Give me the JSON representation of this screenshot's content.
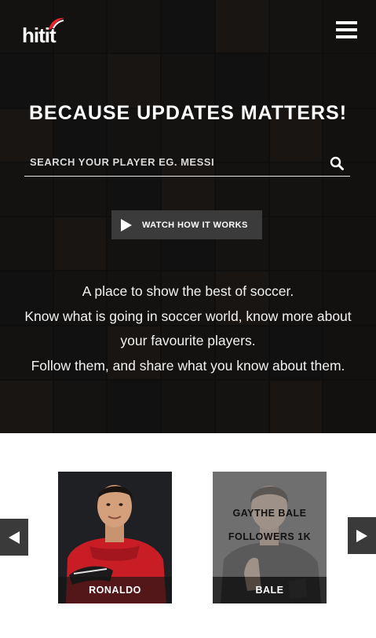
{
  "header": {
    "logo_text": "hitit",
    "menu_icon": "hamburger-menu-icon"
  },
  "hero": {
    "headline": "BECAUSE UPDATES MATTERS!",
    "search": {
      "placeholder": "SEARCH YOUR PLAYER EG. MESSI",
      "value": "",
      "icon": "search-icon"
    },
    "watch_button": {
      "label": "WATCH HOW IT WORKS",
      "icon": "play-icon"
    },
    "tagline": [
      "A place to show the best of soccer.",
      "Know what is going in soccer world, know more about your favourite players.",
      "Follow them, and share what you know about them."
    ]
  },
  "carousel": {
    "prev_icon": "arrow-left-icon",
    "next_icon": "arrow-right-icon",
    "players": [
      {
        "label": "RONALDO"
      },
      {
        "label": "BALE",
        "hover_name": "GAYTHE BALE",
        "hover_followers": "FOLLOWERS 1K"
      }
    ]
  },
  "colors": {
    "hero_overlay": "#0a0a0a",
    "button_bg": "#3b3b3b",
    "text_light": "#ffffff",
    "logo_accent": "#e0262b"
  }
}
